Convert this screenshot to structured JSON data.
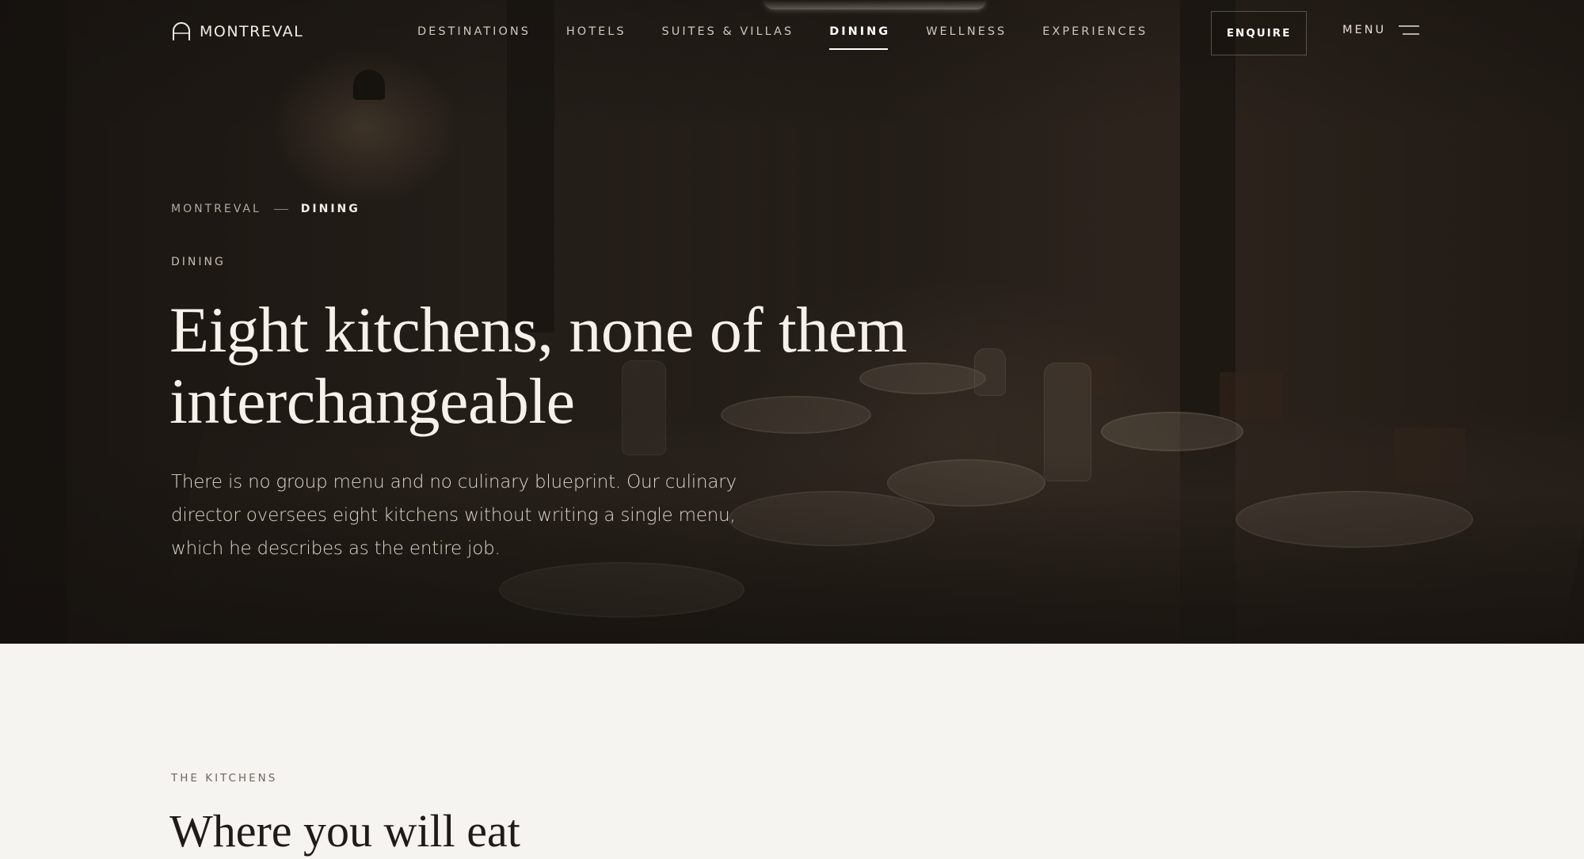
{
  "brand": {
    "name": "MONTREVAL",
    "icon": "arch-logo-icon"
  },
  "nav": {
    "items": [
      {
        "label": "DESTINATIONS",
        "active": false
      },
      {
        "label": "HOTELS",
        "active": false
      },
      {
        "label": "SUITES & VILLAS",
        "active": false
      },
      {
        "label": "DINING",
        "active": true
      },
      {
        "label": "WELLNESS",
        "active": false
      },
      {
        "label": "EXPERIENCES",
        "active": false
      }
    ],
    "enquire_label": "ENQUIRE",
    "menu_label": "MENU",
    "menu_icon": "hamburger-icon"
  },
  "breadcrumb": {
    "root": "MONTREVAL",
    "current": "DINING"
  },
  "hero": {
    "eyebrow": "DINING",
    "headline_line1": "Eight kitchens, none of them",
    "headline_line2": "interchangeable",
    "intro": "There is no group menu and no culinary blueprint. Our culinary director oversees eight kitchens without writing a single menu, which he describes as the entire job."
  },
  "kitchens": {
    "eyebrow": "THE KITCHENS",
    "title": "Where you will eat"
  },
  "colors": {
    "hero_overlay": "#241d18",
    "text_light": "#f6f1ea",
    "page_background": "#f6f4f0",
    "text_dark": "#1f1b17"
  }
}
